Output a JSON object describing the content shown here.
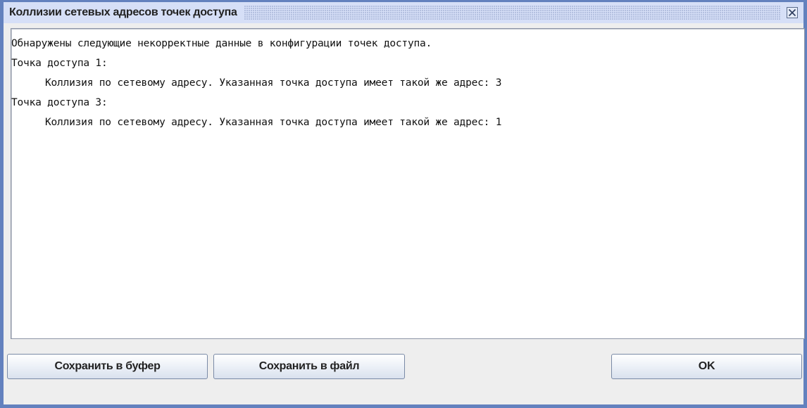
{
  "window": {
    "title": "Коллизии сетевых адресов точек доступа"
  },
  "report": {
    "lines": [
      {
        "text": "Обнаружены следующие некорректные данные в конфигурации точек доступа.",
        "indent": false
      },
      {
        "text": "Точка доступа 1:",
        "indent": false
      },
      {
        "text": "Коллизия по сетевому адресу. Указанная точка доступа имеет такой же адрес: 3",
        "indent": true
      },
      {
        "text": "Точка доступа 3:",
        "indent": false
      },
      {
        "text": "Коллизия по сетевому адресу. Указанная точка доступа имеет такой же адрес: 1",
        "indent": true
      }
    ]
  },
  "buttons": {
    "save_buffer": "Сохранить в буфер",
    "save_file": "Сохранить в файл",
    "ok": "OK"
  },
  "colors": {
    "frame": "#6381be",
    "titlebar": "#d6dff7",
    "dialog_bg": "#eeeeee",
    "text_area_bg": "#ffffff"
  },
  "icons": {
    "close": "close-icon"
  }
}
